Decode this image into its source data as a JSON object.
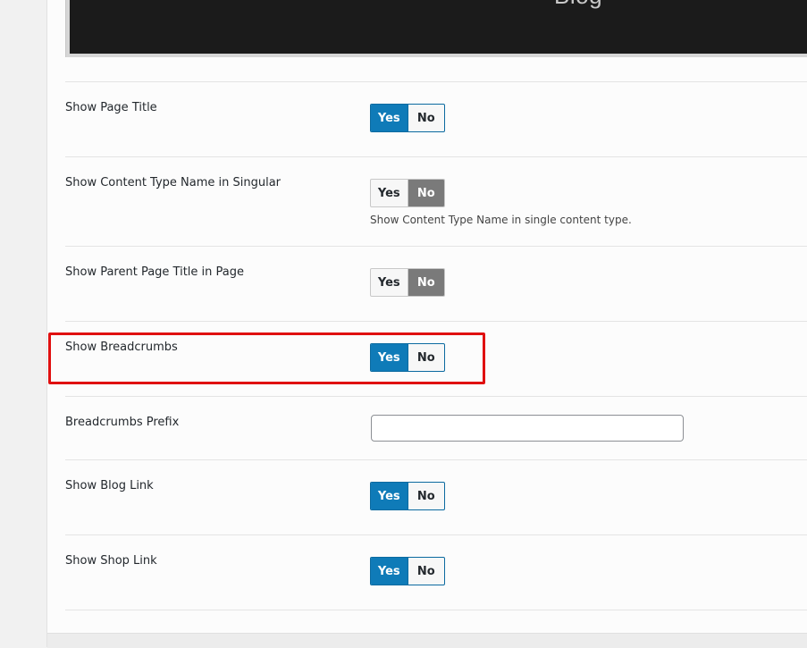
{
  "preview": {
    "text": "Blog"
  },
  "settings": {
    "show_page_title": {
      "label": "Show Page Title",
      "yes": "Yes",
      "no": "No",
      "value": "Yes"
    },
    "show_content_type_name": {
      "label": "Show Content Type Name in Singular",
      "yes": "Yes",
      "no": "No",
      "value": "No",
      "description": "Show Content Type Name in single content type."
    },
    "show_parent_page_title": {
      "label": "Show Parent Page Title in Page",
      "yes": "Yes",
      "no": "No",
      "value": "No"
    },
    "show_breadcrumbs": {
      "label": "Show Breadcrumbs",
      "yes": "Yes",
      "no": "No",
      "value": "Yes"
    },
    "breadcrumbs_prefix": {
      "label": "Breadcrumbs Prefix",
      "value": ""
    },
    "show_blog_link": {
      "label": "Show Blog Link",
      "yes": "Yes",
      "no": "No",
      "value": "Yes"
    },
    "show_shop_link": {
      "label": "Show Shop Link",
      "yes": "Yes",
      "no": "No",
      "value": "Yes"
    }
  },
  "colors": {
    "toggle_on": "#0f7bb8",
    "toggle_off": "#7a7a7a",
    "highlight": "#e01010"
  }
}
